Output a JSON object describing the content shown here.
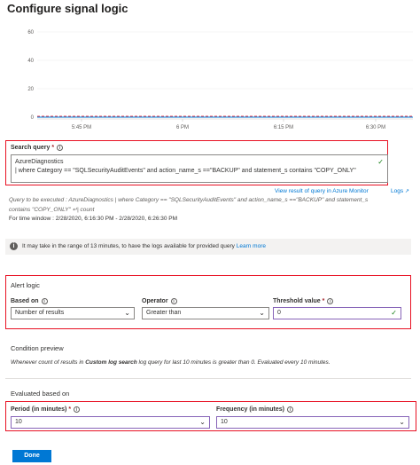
{
  "title": "Configure signal logic",
  "chart_data": {
    "type": "line",
    "x_ticks": [
      "5:45 PM",
      "6 PM",
      "6:15 PM",
      "6:30 PM"
    ],
    "y_ticks": [
      "60",
      "40",
      "20",
      "0"
    ],
    "ylim": [
      0,
      60
    ],
    "series": [
      {
        "values": [
          0,
          0,
          0,
          0,
          0
        ]
      }
    ],
    "threshold": 0,
    "grid": true
  },
  "search_query": {
    "label": "Search query",
    "required": "*",
    "line1": "AzureDiagnostics",
    "line2": "| where Category == \"SQLSecurityAuditEvents\" and action_name_s ==\"BACKUP\" and statement_s contains \"COPY_ONLY\"",
    "view_result_link": "View result of query in Azure Monitor",
    "logs_link": "Logs"
  },
  "query_to_execute": {
    "line1": "Query to be executed : AzureDiagnostics | where Category == \"SQLSecurityAuditEvents\" and action_name_s ==\"BACKUP\" and statement_s",
    "line2": "contains \"COPY_ONLY\" ↵| count",
    "time_window": "For time window : 2/28/2020, 6:16:30 PM - 2/28/2020, 6:26:30 PM"
  },
  "info_bar": {
    "text": "It may take in the range of 13 minutes, to have the logs available for provided query",
    "link": "Learn more"
  },
  "alert_logic": {
    "heading": "Alert logic",
    "based_on_label": "Based on",
    "based_on_value": "Number of results",
    "operator_label": "Operator",
    "operator_value": "Greater than",
    "threshold_label": "Threshold value",
    "threshold_required": "*",
    "threshold_value": "0"
  },
  "condition_preview": {
    "heading": "Condition preview",
    "text_before": "Whenever count of results in",
    "text_bold": "Custom log search",
    "text_after": "log query for last 10 minutes is greater than 0. Evaluated every 10 minutes."
  },
  "evaluated": {
    "heading": "Evaluated based on",
    "period_label": "Period (in minutes)",
    "period_required": "*",
    "period_value": "10",
    "frequency_label": "Frequency (in minutes)",
    "frequency_value": "10"
  },
  "done_label": "Done",
  "colors": {
    "accent": "#0078d4",
    "highlight_box": "#e81123",
    "valid": "#107c10",
    "focus_border": "#8764b8"
  }
}
